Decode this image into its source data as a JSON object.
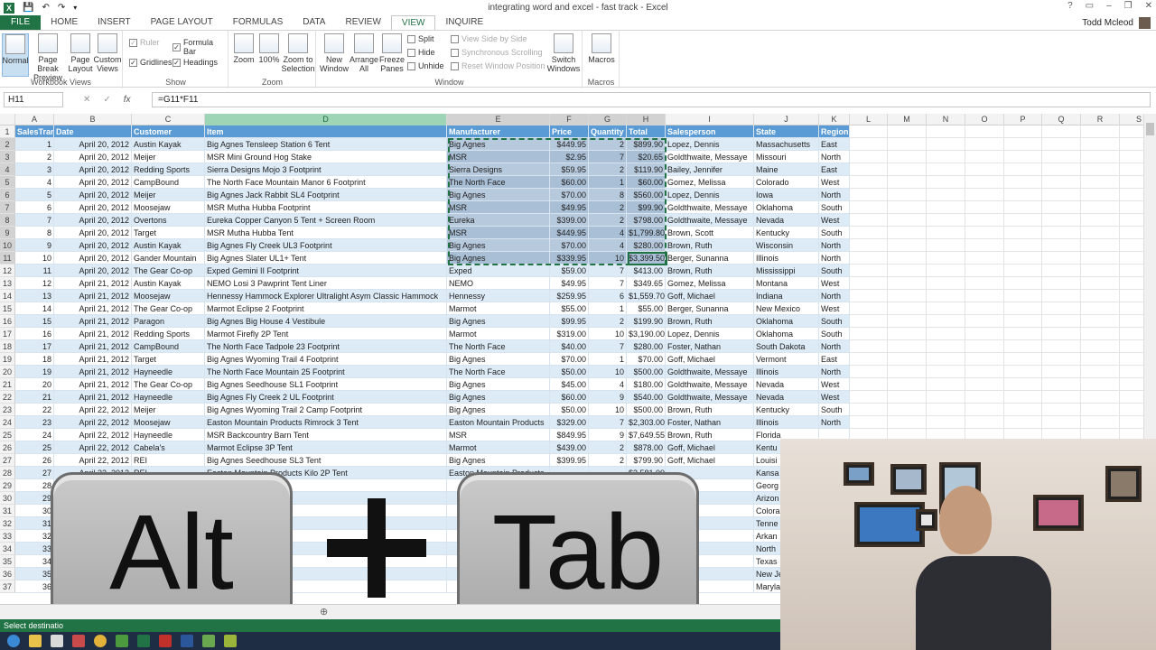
{
  "app": {
    "title": "integrating word and excel - fast track - Excel",
    "user": "Todd Mcleod",
    "help": "?",
    "win_controls": [
      "▭",
      "–",
      "❐",
      "✕"
    ]
  },
  "tabs": [
    "FILE",
    "HOME",
    "INSERT",
    "PAGE LAYOUT",
    "FORMULAS",
    "DATA",
    "REVIEW",
    "VIEW",
    "INQUIRE"
  ],
  "active_tab": "VIEW",
  "ribbon": {
    "workbook_views": {
      "label": "Workbook Views",
      "buttons": [
        "Normal",
        "Page Break Preview",
        "Page Layout",
        "Custom Views"
      ]
    },
    "show": {
      "label": "Show",
      "checks": [
        {
          "label": "Ruler",
          "checked": true,
          "disabled": true
        },
        {
          "label": "Formula Bar",
          "checked": true
        },
        {
          "label": "Gridlines",
          "checked": true
        },
        {
          "label": "Headings",
          "checked": true
        }
      ]
    },
    "zoom": {
      "label": "Zoom",
      "buttons": [
        "Zoom",
        "100%",
        "Zoom to Selection"
      ]
    },
    "window": {
      "label": "Window",
      "buttons": [
        "New Window",
        "Arrange All",
        "Freeze Panes"
      ],
      "small": [
        "Split",
        "Hide",
        "Unhide"
      ],
      "disabled": [
        "View Side by Side",
        "Synchronous Scrolling",
        "Reset Window Position"
      ],
      "switch": "Switch Windows"
    },
    "macros": {
      "label": "Macros",
      "button": "Macros"
    }
  },
  "formula_bar": {
    "name_box": "H11",
    "formula": "=G11*F11",
    "cancel": "✕",
    "enter": "✓",
    "fx": "fx"
  },
  "columns": [
    "A",
    "B",
    "C",
    "D",
    "E",
    "F",
    "G",
    "H",
    "I",
    "J",
    "K",
    "L",
    "M",
    "N",
    "O",
    "P",
    "Q",
    "R",
    "S"
  ],
  "headers": [
    "SalesTran",
    "Date",
    "Customer",
    "Item",
    "Manufacturer",
    "Price",
    "Quantity",
    "Total",
    "Salesperson",
    "State",
    "Region"
  ],
  "rows": [
    [
      "1",
      "April 20, 2012",
      "Austin Kayak",
      "Big Agnes Tensleep Station 6 Tent",
      "Big Agnes",
      "$449.95",
      "2",
      "$899.90",
      "Lopez, Dennis",
      "Massachusetts",
      "East"
    ],
    [
      "2",
      "April 20, 2012",
      "Meijer",
      "MSR Mini Ground Hog Stake",
      "MSR",
      "$2.95",
      "7",
      "$20.65",
      "Goldthwaite, Messaye",
      "Missouri",
      "North"
    ],
    [
      "3",
      "April 20, 2012",
      "Redding Sports",
      "Sierra Designs Mojo 3 Footprint",
      "Sierra Designs",
      "$59.95",
      "2",
      "$119.90",
      "Bailey, Jennifer",
      "Maine",
      "East"
    ],
    [
      "4",
      "April 20, 2012",
      "CampBound",
      "The North Face Mountain Manor 6 Footprint",
      "The North Face",
      "$60.00",
      "1",
      "$60.00",
      "Gomez, Melissa",
      "Colorado",
      "West"
    ],
    [
      "5",
      "April 20, 2012",
      "Meijer",
      "Big Agnes Jack Rabbit SL4 Footprint",
      "Big Agnes",
      "$70.00",
      "8",
      "$560.00",
      "Lopez, Dennis",
      "Iowa",
      "North"
    ],
    [
      "6",
      "April 20, 2012",
      "Moosejaw",
      "MSR Mutha Hubba Footprint",
      "MSR",
      "$49.95",
      "2",
      "$99.90",
      "Goldthwaite, Messaye",
      "Oklahoma",
      "South"
    ],
    [
      "7",
      "April 20, 2012",
      "Overtons",
      "Eureka Copper Canyon 5 Tent + Screen Room",
      "Eureka",
      "$399.00",
      "2",
      "$798.00",
      "Goldthwaite, Messaye",
      "Nevada",
      "West"
    ],
    [
      "8",
      "April 20, 2012",
      "Target",
      "MSR Mutha Hubba Tent",
      "MSR",
      "$449.95",
      "4",
      "$1,799.80",
      "Brown, Scott",
      "Kentucky",
      "South"
    ],
    [
      "9",
      "April 20, 2012",
      "Austin Kayak",
      "Big Agnes Fly Creek UL3 Footprint",
      "Big Agnes",
      "$70.00",
      "4",
      "$280.00",
      "Brown, Ruth",
      "Wisconsin",
      "North"
    ],
    [
      "10",
      "April 20, 2012",
      "Gander Mountain",
      "Big Agnes Slater UL1+ Tent",
      "Big Agnes",
      "$339.95",
      "10",
      "$3,399.50",
      "Berger, Sunanna",
      "Illinois",
      "North"
    ],
    [
      "11",
      "April 20, 2012",
      "The Gear Co-op",
      "Exped Gemini II Footprint",
      "Exped",
      "$59.00",
      "7",
      "$413.00",
      "Brown, Ruth",
      "Mississippi",
      "South"
    ],
    [
      "12",
      "April 21, 2012",
      "Austin Kayak",
      "NEMO Losi 3 Pawprint Tent Liner",
      "NEMO",
      "$49.95",
      "7",
      "$349.65",
      "Gomez, Melissa",
      "Montana",
      "West"
    ],
    [
      "13",
      "April 21, 2012",
      "Moosejaw",
      "Hennessy Hammock Explorer Ultralight Asym Classic Hammock",
      "Hennessy",
      "$259.95",
      "6",
      "$1,559.70",
      "Goff, Michael",
      "Indiana",
      "North"
    ],
    [
      "14",
      "April 21, 2012",
      "The Gear Co-op",
      "Marmot Eclipse 2 Footprint",
      "Marmot",
      "$55.00",
      "1",
      "$55.00",
      "Berger, Sunanna",
      "New Mexico",
      "West"
    ],
    [
      "15",
      "April 21, 2012",
      "Paragon",
      "Big Agnes Big House 4 Vestibule",
      "Big Agnes",
      "$99.95",
      "2",
      "$199.90",
      "Brown, Ruth",
      "Oklahoma",
      "South"
    ],
    [
      "16",
      "April 21, 2012",
      "Redding Sports",
      "Marmot Firefly 2P Tent",
      "Marmot",
      "$319.00",
      "10",
      "$3,190.00",
      "Lopez, Dennis",
      "Oklahoma",
      "South"
    ],
    [
      "17",
      "April 21, 2012",
      "CampBound",
      "The North Face Tadpole 23 Footprint",
      "The North Face",
      "$40.00",
      "7",
      "$280.00",
      "Foster, Nathan",
      "South Dakota",
      "North"
    ],
    [
      "18",
      "April 21, 2012",
      "Target",
      "Big Agnes Wyoming Trail 4 Footprint",
      "Big Agnes",
      "$70.00",
      "1",
      "$70.00",
      "Goff, Michael",
      "Vermont",
      "East"
    ],
    [
      "19",
      "April 21, 2012",
      "Hayneedle",
      "The North Face Mountain 25 Footprint",
      "The North Face",
      "$50.00",
      "10",
      "$500.00",
      "Goldthwaite, Messaye",
      "Illinois",
      "North"
    ],
    [
      "20",
      "April 21, 2012",
      "The Gear Co-op",
      "Big Agnes Seedhouse SL1 Footprint",
      "Big Agnes",
      "$45.00",
      "4",
      "$180.00",
      "Goldthwaite, Messaye",
      "Nevada",
      "West"
    ],
    [
      "21",
      "April 21, 2012",
      "Hayneedle",
      "Big Agnes Fly Creek 2 UL Footprint",
      "Big Agnes",
      "$60.00",
      "9",
      "$540.00",
      "Goldthwaite, Messaye",
      "Nevada",
      "West"
    ],
    [
      "22",
      "April 22, 2012",
      "Meijer",
      "Big Agnes Wyoming Trail 2 Camp Footprint",
      "Big Agnes",
      "$50.00",
      "10",
      "$500.00",
      "Brown, Ruth",
      "Kentucky",
      "South"
    ],
    [
      "23",
      "April 22, 2012",
      "Moosejaw",
      "Easton Mountain Products Rimrock 3 Tent",
      "Easton Mountain Products",
      "$329.00",
      "7",
      "$2,303.00",
      "Foster, Nathan",
      "Illinois",
      "North"
    ],
    [
      "24",
      "April 22, 2012",
      "Hayneedle",
      "MSR Backcountry Barn Tent",
      "MSR",
      "$849.95",
      "9",
      "$7,649.55",
      "Brown, Ruth",
      "Florida",
      ""
    ],
    [
      "25",
      "April 22, 2012",
      "Cabela's",
      "Marmot Eclipse 3P Tent",
      "Marmot",
      "$439.00",
      "2",
      "$878.00",
      "Goff, Michael",
      "Kentu",
      ""
    ],
    [
      "26",
      "April 22, 2012",
      "REI",
      "Big Agnes Seedhouse SL3 Tent",
      "Big Agnes",
      "$399.95",
      "2",
      "$799.90",
      "Goff, Michael",
      "Louisi",
      ""
    ],
    [
      "27",
      "April 22, 2012",
      "REI",
      "Easton Mountain Products Kilo 2P Tent",
      "Easton Mountain Products",
      "",
      "",
      "$2,581.00",
      "",
      "Kansa",
      ""
    ],
    [
      "28",
      "",
      "",
      "",
      "",
      "",
      "",
      "",
      "Melissa",
      "Georg",
      ""
    ],
    [
      "29",
      "",
      "",
      "UL3 Tent",
      "",
      "",
      "",
      "",
      "uth",
      "Arizon",
      ""
    ],
    [
      "30",
      "",
      "",
      "",
      "",
      "",
      "",
      "",
      "Sharon",
      "Colora",
      ""
    ],
    [
      "31",
      "",
      "",
      "print",
      "",
      "",
      "",
      "",
      "unanna",
      "Tenne",
      ""
    ],
    [
      "32",
      "",
      "",
      "nd 4 Tent",
      "",
      "",
      "",
      "",
      "uth",
      "Arkan",
      ""
    ],
    [
      "33",
      "",
      "",
      "2 Tent",
      "",
      "",
      "",
      "",
      "ennifer",
      "North",
      ""
    ],
    [
      "34",
      "",
      "",
      "nt",
      "",
      "",
      "",
      "",
      "uth",
      "Texas",
      ""
    ],
    [
      "35",
      "",
      "",
      "5 Tent + Screen Room",
      "",
      "",
      "",
      "",
      "uth",
      "New Je",
      ""
    ],
    [
      "36",
      "",
      "",
      "helter Wall",
      "",
      "",
      "",
      "",
      "cott",
      "Maryla",
      ""
    ]
  ],
  "overlay": {
    "key1": "Alt",
    "key2": "Tab"
  },
  "status_text": "Select destinatio"
}
